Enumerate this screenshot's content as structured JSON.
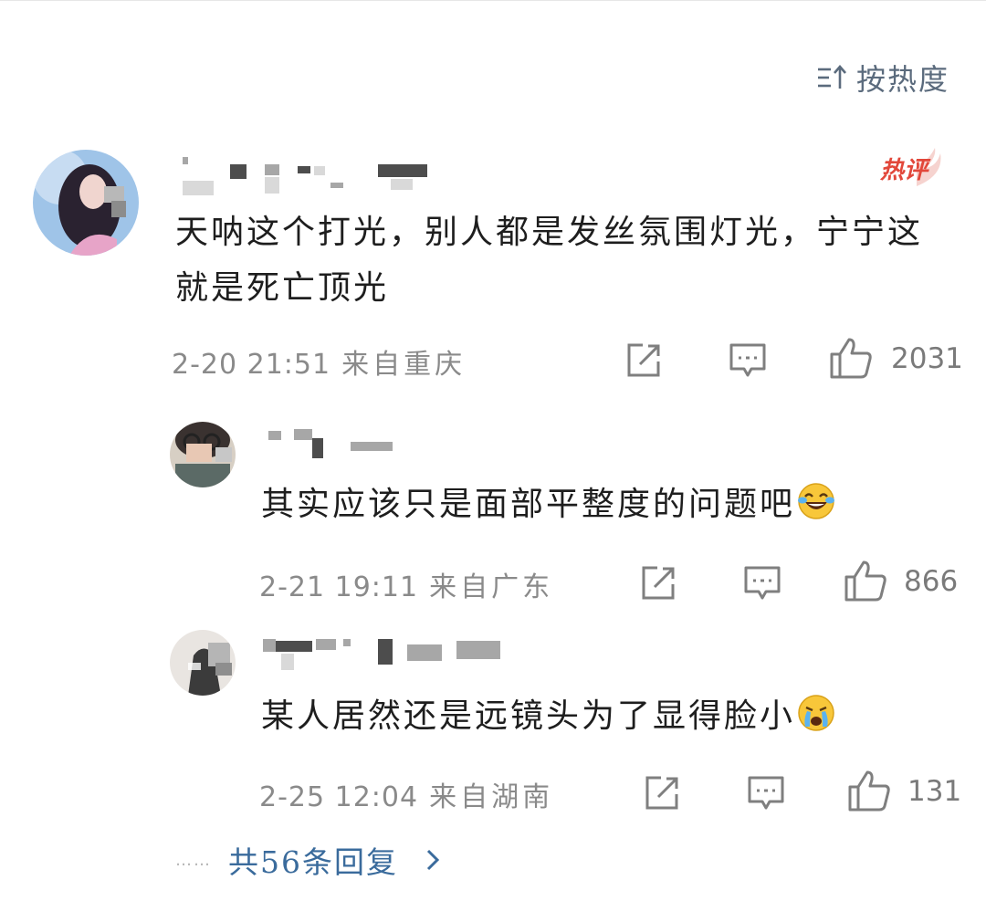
{
  "sort": {
    "label": "按热度",
    "icon": "sort-icon"
  },
  "comment": {
    "hot_badge": "热评",
    "text": "天呐这个打光，别人都是发丝氛围灯光，宁宁这就是死亡顶光",
    "time": "2-20 21:51",
    "location": "来自重庆",
    "likes": "2031"
  },
  "replies": [
    {
      "text": "其实应该只是面部平整度的问题吧",
      "emoji": "laughing-tears-emoji",
      "time": "2-21 19:11",
      "location": "来自广东",
      "likes": "866"
    },
    {
      "text": "某人居然还是远镜头为了显得脸小",
      "emoji": "crying-face-emoji",
      "time": "2-25 12:04",
      "location": "来自湖南",
      "likes": "131"
    }
  ],
  "more_replies": {
    "dots": "……",
    "label": "共56条回复"
  },
  "colors": {
    "accent": "#3a6b9c",
    "hot": "#e2473a",
    "meta": "#8a8a8a"
  }
}
